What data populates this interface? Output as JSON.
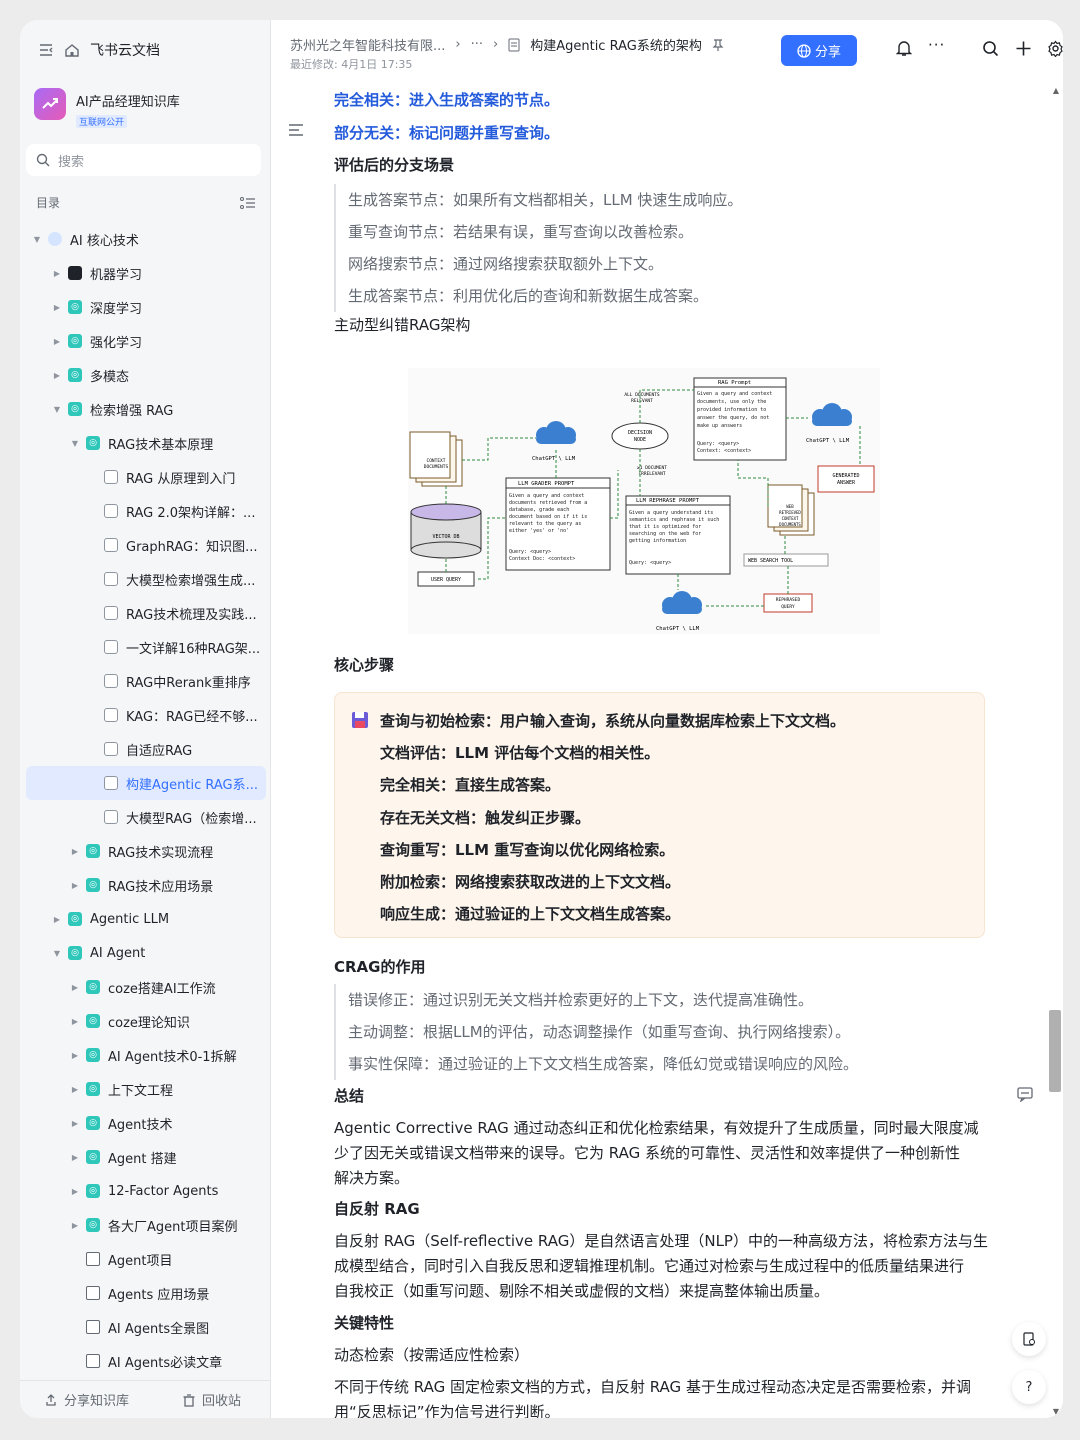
{
  "sidebar": {
    "app_name": "飞书云文档",
    "kb_name": "AI产品经理知识库",
    "kb_badge": "互联网公开",
    "search_placeholder": "搜索",
    "toc_label": "目录",
    "tree": [
      {
        "label": "AI 核心技术",
        "level": 0,
        "caret": "down",
        "icon": "globe"
      },
      {
        "label": "机器学习",
        "level": 1,
        "caret": "right",
        "icon": "robot"
      },
      {
        "label": "深度学习",
        "level": 1,
        "caret": "right",
        "icon": "teal"
      },
      {
        "label": "强化学习",
        "level": 1,
        "caret": "right",
        "icon": "teal"
      },
      {
        "label": "多模态",
        "level": 1,
        "caret": "right",
        "icon": "teal"
      },
      {
        "label": "检索增强 RAG",
        "level": 1,
        "caret": "down",
        "icon": "teal"
      },
      {
        "label": "RAG技术基本原理",
        "level": 2,
        "caret": "down",
        "icon": "teal"
      },
      {
        "label": "RAG 从原理到入门",
        "level": 3,
        "caret": "",
        "icon": "doc"
      },
      {
        "label": "RAG 2.0架构详解：...",
        "level": 3,
        "caret": "",
        "icon": "doc"
      },
      {
        "label": "GraphRAG：知识图...",
        "level": 3,
        "caret": "",
        "icon": "doc"
      },
      {
        "label": "大模型检索增强生成...",
        "level": 3,
        "caret": "",
        "icon": "doc"
      },
      {
        "label": "RAG技术梳理及实践...",
        "level": 3,
        "caret": "",
        "icon": "doc"
      },
      {
        "label": "一文详解16种RAG架...",
        "level": 3,
        "caret": "",
        "icon": "doc"
      },
      {
        "label": "RAG中Rerank重排序",
        "level": 3,
        "caret": "",
        "icon": "doc"
      },
      {
        "label": "KAG：RAG已经不够...",
        "level": 3,
        "caret": "",
        "icon": "doc"
      },
      {
        "label": "自适应RAG",
        "level": 3,
        "caret": "",
        "icon": "doc"
      },
      {
        "label": "构建Agentic RAG系...",
        "level": 3,
        "caret": "",
        "icon": "doc",
        "active": true
      },
      {
        "label": "大模型RAG（检索增...",
        "level": 3,
        "caret": "",
        "icon": "doc"
      },
      {
        "label": "RAG技术实现流程",
        "level": 2,
        "caret": "right",
        "icon": "teal"
      },
      {
        "label": "RAG技术应用场景",
        "level": 2,
        "caret": "right",
        "icon": "teal"
      },
      {
        "label": "Agentic LLM",
        "level": 1,
        "caret": "right",
        "icon": "teal"
      },
      {
        "label": "AI Agent",
        "level": 1,
        "caret": "down",
        "icon": "teal"
      },
      {
        "label": "coze搭建AI工作流",
        "level": 2,
        "caret": "right",
        "icon": "teal"
      },
      {
        "label": "coze理论知识",
        "level": 2,
        "caret": "right",
        "icon": "teal"
      },
      {
        "label": "AI Agent技术0-1拆解",
        "level": 2,
        "caret": "right",
        "icon": "teal"
      },
      {
        "label": "上下文工程",
        "level": 2,
        "caret": "right",
        "icon": "teal"
      },
      {
        "label": "Agent技术",
        "level": 2,
        "caret": "right",
        "icon": "teal"
      },
      {
        "label": "Agent 搭建",
        "level": 2,
        "caret": "right",
        "icon": "teal"
      },
      {
        "label": "12-Factor Agents",
        "level": 2,
        "caret": "right",
        "icon": "teal"
      },
      {
        "label": "各大厂Agent项目案例",
        "level": 2,
        "caret": "right",
        "icon": "teal"
      },
      {
        "label": "Agent项目",
        "level": 2,
        "caret": "",
        "icon": "box"
      },
      {
        "label": "Agents 应用场景",
        "level": 2,
        "caret": "",
        "icon": "box"
      },
      {
        "label": "AI Agents全景图",
        "level": 2,
        "caret": "",
        "icon": "box"
      },
      {
        "label": "AI Agents必读文章",
        "level": 2,
        "caret": "",
        "icon": "box"
      }
    ],
    "footer_share": "分享知识库",
    "footer_trash": "回收站"
  },
  "header": {
    "crumb_org": "苏州光之年智能科技有限...",
    "crumb_more": "···",
    "crumb_doc": "构建Agentic RAG系统的架构",
    "modified": "最近修改: 4月1日 17:35",
    "share_label": "分享"
  },
  "doc": {
    "link1": "完全相关：进入生成答案的节点。",
    "link2": "部分无关：标记问题并重写查询。",
    "branch_title": "评估后的分支场景",
    "branch_items": [
      "生成答案节点：如果所有文档都相关，LLM 快速生成响应。",
      "重写查询节点：若结果有误，重写查询以改善检索。",
      "网络搜索节点：通过网络搜索获取额外上下文。",
      "生成答案节点：利用优化后的查询和新数据生成答案。"
    ],
    "arch_title": "主动型纠错RAG架构",
    "diagram": {
      "rag_prompt_title": "RAG Prompt",
      "rag_prompt_body": [
        "Given a query and context",
        "documents, use only the",
        "provided information to",
        "answer the query, do not",
        "make up answers"
      ],
      "rag_prompt_query": [
        "Query: <query>",
        "Context: <context>"
      ],
      "all_docs_relevant": [
        "ALL DOCUMENTS",
        "RELEVANT"
      ],
      "decision_node": [
        "DECISION",
        "NODE"
      ],
      "chatgpt_llm": "ChatGPT \\ LLM",
      "generated_answer": [
        "GENERATED",
        "ANSWER"
      ],
      "context_documents": [
        "CONTEXT",
        "DOCUMENTS"
      ],
      "grader_title": "LLM GRADER PROMPT",
      "grader_body": [
        "Given a query and context",
        "documents retrieved from a",
        "database, grade each",
        "document based on if it is",
        "relevant to the query as",
        "either 'yes' or 'no'"
      ],
      "grader_query": [
        "Query: <query>",
        "Context Doc: <context>"
      ],
      "one_doc_irrelevant": [
        "≥1 DOCUMENT",
        "IRRELEVANT"
      ],
      "rephrase_title": "LLM REPHRASE PROMPT",
      "rephrase_body": [
        "Given a query understand its",
        "semantics and rephrase it such",
        "that it is optimized for",
        "searching on the web for",
        "getting information"
      ],
      "rephrase_query": "Query: <query>",
      "web_retrieved": [
        "WEB",
        "RETRIEVED",
        "CONTEXT",
        "DOCUMENTS"
      ],
      "web_search_tool": "WEB SEARCH TOOL",
      "vector_db": "VECTOR DB",
      "user_query": "USER QUERY",
      "rephrased_query": [
        "REPHRASED",
        "QUERY"
      ]
    },
    "core_title": "核心步骤",
    "callout_items": [
      "查询与初始检索：用户输入查询，系统从向量数据库检索上下文文档。",
      "文档评估：LLM 评估每个文档的相关性。",
      "完全相关：直接生成答案。",
      "存在无关文档：触发纠正步骤。",
      "查询重写：LLM 重写查询以优化网络检索。",
      "附加检索：网络搜索获取改进的上下文文档。",
      "响应生成：通过验证的上下文文档生成答案。"
    ],
    "crag_title": "CRAG的作用",
    "crag_items": [
      "错误修正：通过识别无关文档并检索更好的上下文，迭代提高准确性。",
      "主动调整：根据LLM的评估，动态调整操作（如重写查询、执行网络搜索）。",
      "事实性保障：通过验证的上下文文档生成答案，降低幻觉或错误响应的风险。"
    ],
    "summary_title": "总结",
    "summary_lines": [
      "Agentic Corrective RAG 通过动态纠正和优化检索结果，有效提升了生成质量，同时最大限度减",
      "少了因无关或错误文档带来的误导。它为 RAG 系统的可靠性、灵活性和效率提供了一种创新性",
      "解决方案。"
    ],
    "selfrag_title": "自反射 RAG",
    "selfrag_lines": [
      "自反射 RAG（Self-reflective RAG）是自然语言处理（NLP）中的一种高级方法，将检索方法与生",
      "成模型结合，同时引入自我反思和逻辑推理机制。它通过对检索与生成过程中的低质量结果进行",
      "自我校正（如重写问题、剔除不相关或虚假的文档）来提高整体输出质量。"
    ],
    "key_title": "关键特性",
    "key_item": "动态检索（按需适应性检索）",
    "key_lines": [
      "不同于传统 RAG 固定检索文档的方式，自反射 RAG 基于生成过程动态决定是否需要检索，并调",
      "用“反思标记”作为信号进行判断。"
    ]
  },
  "colors": {
    "accent": "#3370ff",
    "link": "#245bdb",
    "callout_bg": "#fef5ec",
    "teal": "#30c7bb"
  }
}
